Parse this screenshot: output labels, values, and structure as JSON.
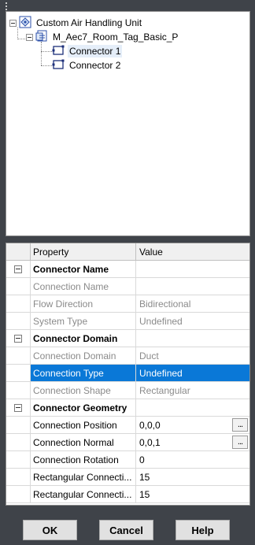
{
  "tree": {
    "root": {
      "label": "Custom Air Handling Unit",
      "icon": "assembly-icon"
    },
    "child": {
      "label": "M_Aec7_Room_Tag_Basic_P",
      "icon": "family-icon"
    },
    "connectors": [
      {
        "label": "Connector 1",
        "icon": "connector-icon",
        "selected": true
      },
      {
        "label": "Connector 2",
        "icon": "connector-icon",
        "selected": false
      }
    ]
  },
  "grid": {
    "header": {
      "property": "Property",
      "value": "Value"
    },
    "rows": [
      {
        "type": "category",
        "property": "Connector Name",
        "value": ""
      },
      {
        "type": "disabled",
        "property": "Connection Name",
        "value": ""
      },
      {
        "type": "disabled",
        "property": "Flow Direction",
        "value": "Bidirectional"
      },
      {
        "type": "disabled",
        "property": "System Type",
        "value": "Undefined"
      },
      {
        "type": "category",
        "property": "Connector Domain",
        "value": ""
      },
      {
        "type": "disabled",
        "property": "Connection Domain",
        "value": "Duct"
      },
      {
        "type": "selected",
        "property": "Connection Type",
        "value": "Undefined"
      },
      {
        "type": "disabled",
        "property": "Connection Shape",
        "value": "Rectangular"
      },
      {
        "type": "category",
        "property": "Connector Geometry",
        "value": ""
      },
      {
        "type": "normal",
        "property": "Connection Position",
        "value": "0,0,0",
        "button": "..."
      },
      {
        "type": "normal",
        "property": "Connection Normal",
        "value": "0,0,1",
        "button": "..."
      },
      {
        "type": "normal",
        "property": "Connection Rotation",
        "value": "0"
      },
      {
        "type": "normal",
        "property": "Rectangular Connecti...",
        "value": "15"
      },
      {
        "type": "normal",
        "property": "Rectangular Connecti...",
        "value": "15"
      }
    ]
  },
  "buttons": {
    "ok": "OK",
    "cancel": "Cancel",
    "help": "Help"
  },
  "colors": {
    "background": "#3f4349",
    "selection": "#0a78d7",
    "disabled_text": "#8a8a8a"
  }
}
